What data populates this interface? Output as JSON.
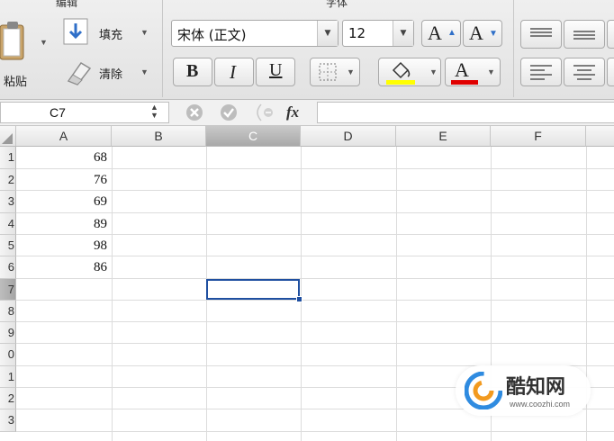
{
  "ribbon": {
    "edit_group_title": "编辑",
    "font_group_title": "字体",
    "paste_label": "粘贴",
    "fill_label": "填充",
    "clear_label": "清除",
    "font_name": "宋体 (正文)",
    "font_size": "12",
    "bold_label": "B",
    "italic_label": "I",
    "underline_label": "U",
    "grow_font_label": "A",
    "shrink_font_label": "A",
    "font_color_label": "A",
    "highlight_color": "#ffff00",
    "font_color": "#e00000"
  },
  "formula_bar": {
    "name_box": "C7",
    "fx_label": "fx",
    "formula": ""
  },
  "sheet": {
    "columns": [
      "A",
      "B",
      "C",
      "D",
      "E",
      "F"
    ],
    "selected_column": "C",
    "row_numbers": [
      "1",
      "2",
      "3",
      "4",
      "5",
      "6",
      "7",
      "8",
      "9",
      "0",
      "1",
      "2",
      "3"
    ],
    "column_a_values": [
      "68",
      "76",
      "69",
      "89",
      "98",
      "86"
    ],
    "active_cell": "C7",
    "selection_color": "#1f4fa0"
  },
  "watermark": {
    "brand": "酷知网",
    "url": "www.coozhi.com"
  }
}
